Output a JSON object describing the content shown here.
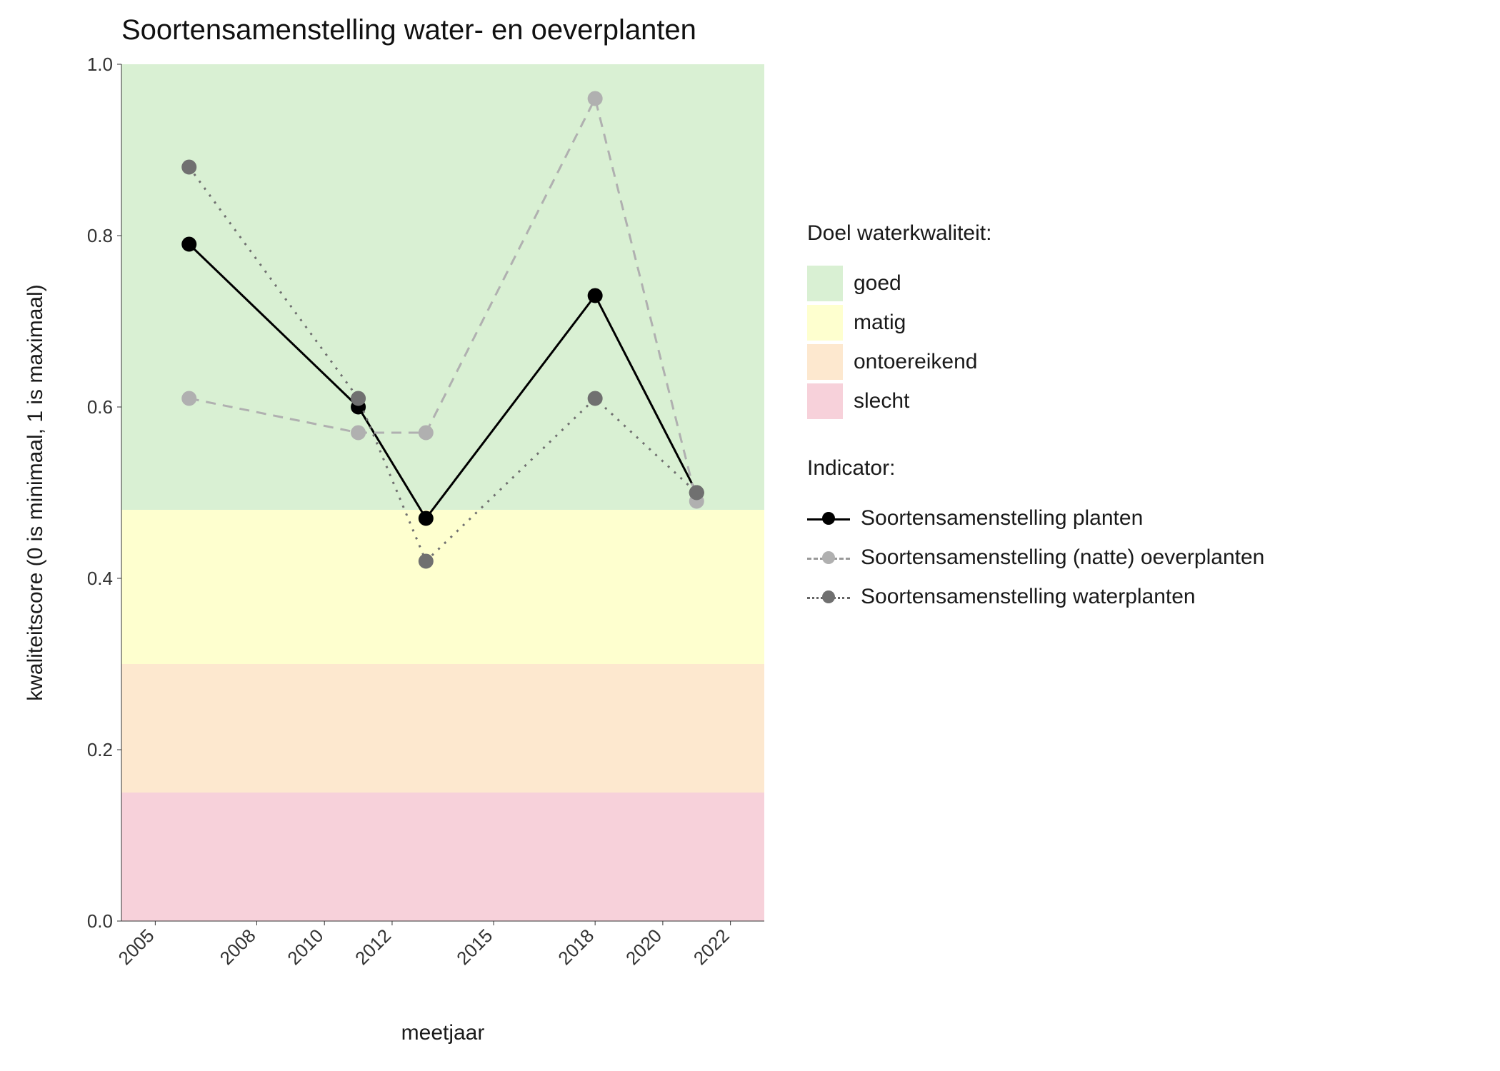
{
  "title": "Soortensamenstelling water- en oeverplanten",
  "ylabel": "kwaliteitscore (0 is minimaal, 1 is maximaal)",
  "xlabel": "meetjaar",
  "legend_band_title": "Doel waterkwaliteit:",
  "legend_indicator_title": "Indicator:",
  "bands": {
    "goed": "goed",
    "matig": "matig",
    "ontoereikend": "ontoereikend",
    "slecht": "slecht"
  },
  "indicators": {
    "planten": "Soortensamenstelling planten",
    "oever": "Soortensamenstelling (natte) oeverplanten",
    "water": "Soortensamenstelling waterplanten"
  },
  "x_ticks": [
    "2005",
    "2008",
    "2010",
    "2012",
    "2015",
    "2018",
    "2020",
    "2022"
  ],
  "y_ticks": [
    "0.0",
    "0.2",
    "0.4",
    "0.6",
    "0.8",
    "1.0"
  ],
  "chart_data": {
    "type": "line",
    "title": "Soortensamenstelling water- en oeverplanten",
    "xlabel": "meetjaar",
    "ylabel": "kwaliteitscore (0 is minimaal, 1 is maximaal)",
    "xlim": [
      2004,
      2023
    ],
    "ylim": [
      0.0,
      1.0
    ],
    "x_ticks": [
      2005,
      2008,
      2010,
      2012,
      2015,
      2018,
      2020,
      2022
    ],
    "y_ticks": [
      0.0,
      0.2,
      0.4,
      0.6,
      0.8,
      1.0
    ],
    "bands": [
      {
        "name": "goed",
        "ymin": 0.48,
        "ymax": 1.0,
        "color": "#d9f0d3"
      },
      {
        "name": "matig",
        "ymin": 0.3,
        "ymax": 0.48,
        "color": "#feffcf"
      },
      {
        "name": "ontoereikend",
        "ymin": 0.15,
        "ymax": 0.3,
        "color": "#fde8cf"
      },
      {
        "name": "slecht",
        "ymin": 0.0,
        "ymax": 0.15,
        "color": "#f7d1da"
      }
    ],
    "series": [
      {
        "name": "Soortensamenstelling planten",
        "style": "solid",
        "color": "#000000",
        "x": [
          2006,
          2011,
          2013,
          2018,
          2021
        ],
        "y": [
          0.79,
          0.6,
          0.47,
          0.73,
          0.5
        ]
      },
      {
        "name": "Soortensamenstelling (natte) oeverplanten",
        "style": "dashed",
        "color": "#b0b0b0",
        "x": [
          2006,
          2011,
          2013,
          2018,
          2021
        ],
        "y": [
          0.61,
          0.57,
          0.57,
          0.96,
          0.49
        ]
      },
      {
        "name": "Soortensamenstelling waterplanten",
        "style": "dotted",
        "color": "#707070",
        "x": [
          2006,
          2011,
          2013,
          2018,
          2021
        ],
        "y": [
          0.88,
          0.61,
          0.42,
          0.61,
          0.5
        ]
      }
    ],
    "legend_position": "right"
  }
}
